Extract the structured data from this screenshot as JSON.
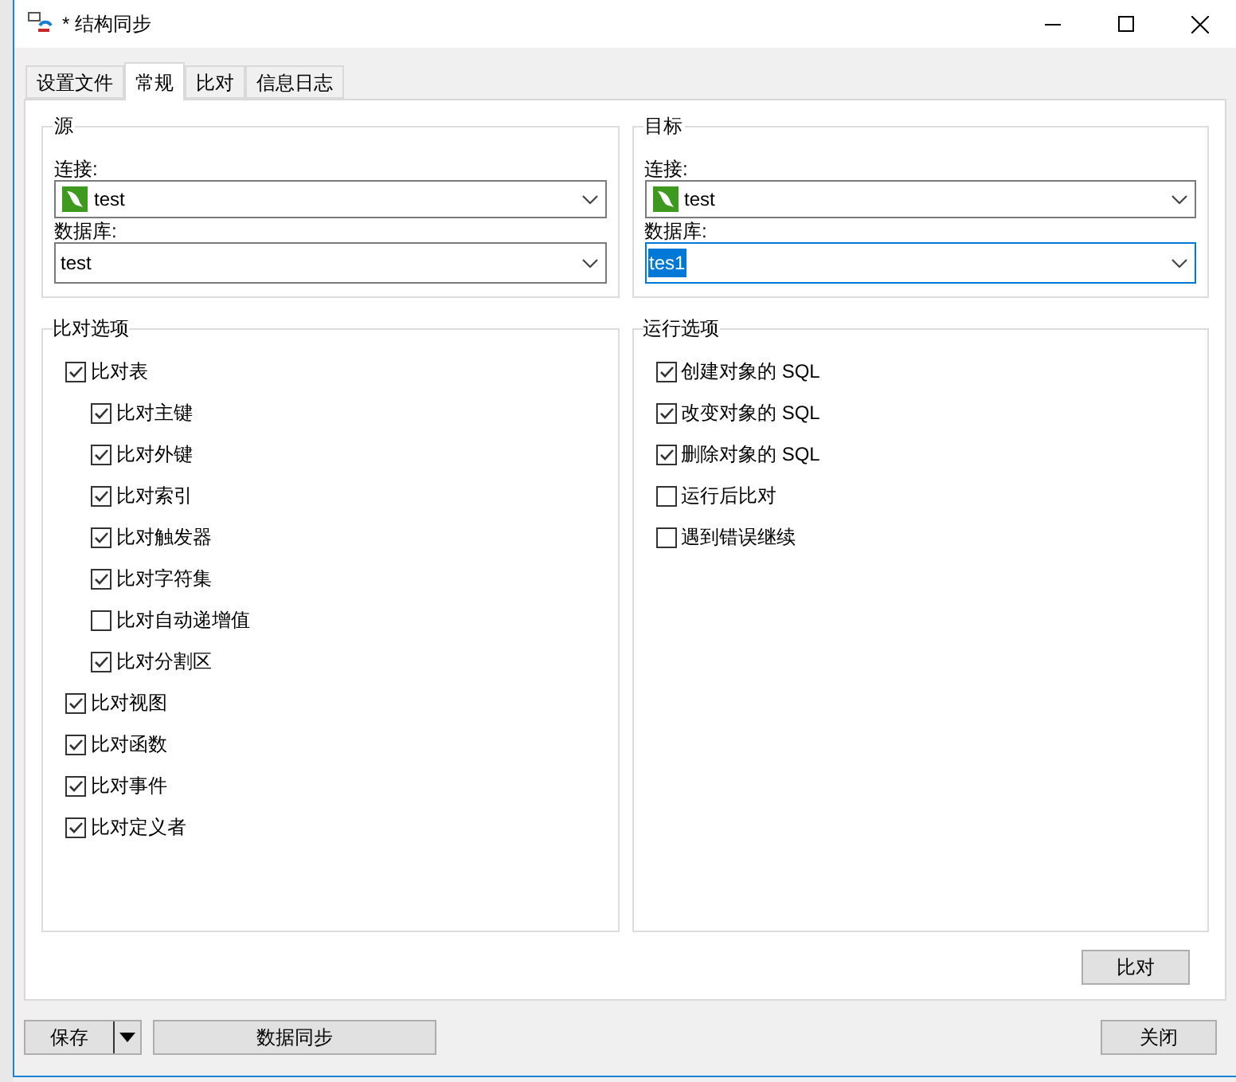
{
  "window": {
    "title": "* 结构同步"
  },
  "tabs": [
    {
      "label": "设置文件",
      "selected": false
    },
    {
      "label": "常规",
      "selected": true
    },
    {
      "label": "比对",
      "selected": false
    },
    {
      "label": "信息日志",
      "selected": false
    }
  ],
  "source": {
    "title": "源",
    "connection_label": "连接:",
    "connection": "test",
    "database_label": "数据库:",
    "database": "test",
    "database_focused": false
  },
  "target": {
    "title": "目标",
    "connection_label": "连接:",
    "connection": "test",
    "database_label": "数据库:",
    "database": "tes1",
    "database_focused": true
  },
  "compare_options": {
    "title": "比对选项",
    "items": [
      {
        "label": "比对表",
        "checked": true,
        "children": [
          {
            "label": "比对主键",
            "checked": true
          },
          {
            "label": "比对外键",
            "checked": true
          },
          {
            "label": "比对索引",
            "checked": true
          },
          {
            "label": "比对触发器",
            "checked": true
          },
          {
            "label": "比对字符集",
            "checked": true
          },
          {
            "label": "比对自动递增值",
            "checked": false
          },
          {
            "label": "比对分割区",
            "checked": true
          }
        ]
      },
      {
        "label": "比对视图",
        "checked": true
      },
      {
        "label": "比对函数",
        "checked": true
      },
      {
        "label": "比对事件",
        "checked": true
      },
      {
        "label": "比对定义者",
        "checked": true
      }
    ]
  },
  "run_options": {
    "title": "运行选项",
    "items": [
      {
        "label": "创建对象的 SQL",
        "checked": true
      },
      {
        "label": "改变对象的 SQL",
        "checked": true
      },
      {
        "label": "删除对象的 SQL",
        "checked": true
      },
      {
        "label": "运行后比对",
        "checked": false
      },
      {
        "label": "遇到错误继续",
        "checked": false
      }
    ]
  },
  "compare_button": "比对",
  "buttons": {
    "save": "保存",
    "sync": "数据同步",
    "close": "关闭"
  }
}
